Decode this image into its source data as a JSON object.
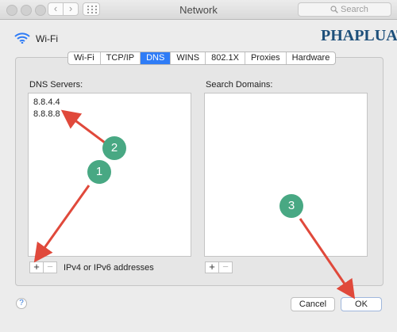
{
  "window": {
    "title": "Network",
    "search_placeholder": "Search"
  },
  "header": {
    "interface_name": "Wi-Fi",
    "watermark_logo": "PHAPLUAT"
  },
  "tabs": [
    {
      "label": "Wi-Fi",
      "active": false
    },
    {
      "label": "TCP/IP",
      "active": false
    },
    {
      "label": "DNS",
      "active": true
    },
    {
      "label": "WINS",
      "active": false
    },
    {
      "label": "802.1X",
      "active": false
    },
    {
      "label": "Proxies",
      "active": false
    },
    {
      "label": "Hardware",
      "active": false
    }
  ],
  "dns": {
    "label": "DNS Servers:",
    "servers": [
      "8.8.4.4",
      "8.8.8.8"
    ],
    "plus": "+",
    "minus": "−",
    "hint": "IPv4 or IPv6 addresses"
  },
  "search_domains": {
    "label": "Search Domains:",
    "plus": "+",
    "minus": "−"
  },
  "footer": {
    "help": "?",
    "cancel_label": "Cancel",
    "ok_label": "OK"
  },
  "annotations": {
    "badges": [
      "1",
      "2",
      "3"
    ],
    "badge_color": "#48a883",
    "arrow_color": "#e0493b"
  },
  "colors": {
    "active_tab": "#2f7cf6",
    "logo": "#1d4f7a"
  }
}
